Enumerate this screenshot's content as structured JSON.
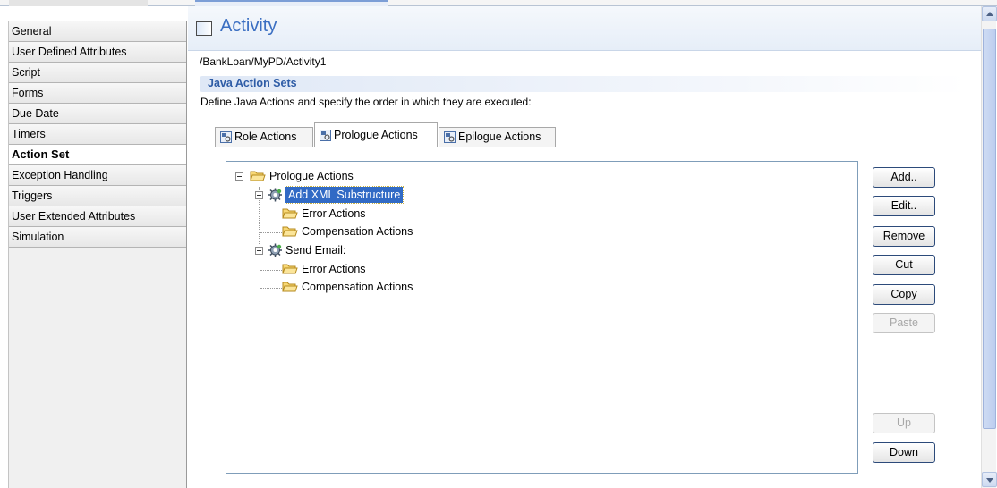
{
  "nav": {
    "items": [
      {
        "label": "General",
        "active": false
      },
      {
        "label": "User Defined Attributes",
        "active": false
      },
      {
        "label": "Script",
        "active": false
      },
      {
        "label": "Forms",
        "active": false
      },
      {
        "label": "Due Date",
        "active": false
      },
      {
        "label": "Timers",
        "active": false
      },
      {
        "label": "Action Set",
        "active": true
      },
      {
        "label": "Exception Handling",
        "active": false
      },
      {
        "label": "Triggers",
        "active": false
      },
      {
        "label": "User Extended Attributes",
        "active": false
      },
      {
        "label": "Simulation",
        "active": false
      }
    ]
  },
  "header": {
    "title": "Activity",
    "icon": "activity-window-icon"
  },
  "path": "/BankLoan/MyPD/Activity1",
  "section": {
    "title": "Java Action Sets",
    "description": "Define Java Actions and specify the order in which they are executed:"
  },
  "tabs": [
    {
      "label": "Role Actions",
      "icon": "action-set-icon",
      "active": false
    },
    {
      "label": "Prologue Actions",
      "icon": "action-set-icon",
      "active": true
    },
    {
      "label": "Epilogue Actions",
      "icon": "action-set-icon",
      "active": false
    }
  ],
  "tree": {
    "root": "Prologue Actions",
    "node1": "Add XML Substructure",
    "node1_error": "Error Actions",
    "node1_comp": "Compensation Actions",
    "node2": "Send Email:",
    "node2_error": "Error Actions",
    "node2_comp": "Compensation Actions"
  },
  "buttons": {
    "add": "Add..",
    "edit": "Edit..",
    "remove": "Remove",
    "cut": "Cut",
    "copy": "Copy",
    "paste": "Paste",
    "up": "Up",
    "down": "Down"
  },
  "colors": {
    "accent": "#3b6fc2",
    "selection": "#316ac5",
    "section_title": "#2e5ca6"
  }
}
